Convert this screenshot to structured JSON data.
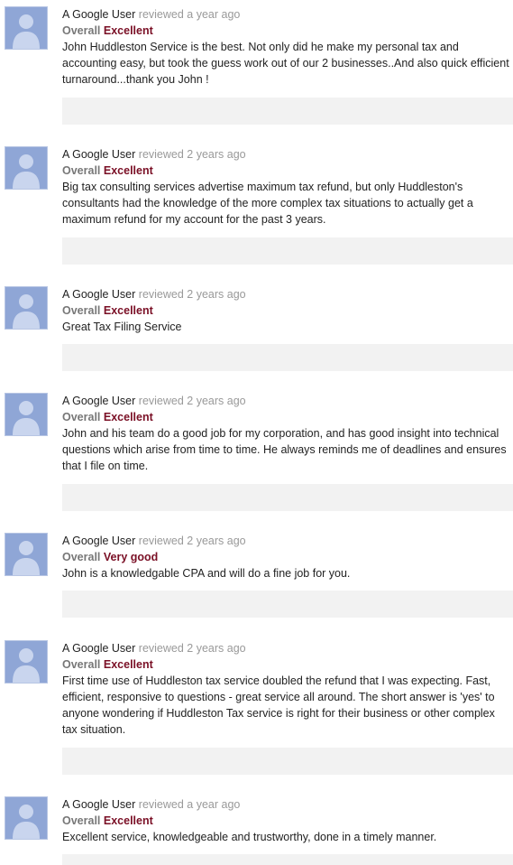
{
  "reviews": [
    {
      "author": "A Google User",
      "reviewed_text": "reviewed a year ago",
      "rating_label": "Overall",
      "rating_value": "Excellent",
      "text": "John Huddleston Service is the best. Not only did he make my personal tax and accounting easy, but took the guess work out of our 2 businesses..And also quick efficient turnaround...thank you John !"
    },
    {
      "author": "A Google User",
      "reviewed_text": "reviewed 2 years ago",
      "rating_label": "Overall",
      "rating_value": "Excellent",
      "text": "Big tax consulting services advertise maximum tax refund, but only Huddleston's consultants had the knowledge of the more complex tax situations to actually get a maximum refund for my account for the past 3 years."
    },
    {
      "author": "A Google User",
      "reviewed_text": "reviewed 2 years ago",
      "rating_label": "Overall",
      "rating_value": "Excellent",
      "text": "Great Tax Filing Service"
    },
    {
      "author": "A Google User",
      "reviewed_text": "reviewed 2 years ago",
      "rating_label": "Overall",
      "rating_value": "Excellent",
      "text": "John and his team do a good job for my corporation, and has good insight into technical questions which arise from time to time. He always reminds me of deadlines and ensures that I file on time."
    },
    {
      "author": "A Google User",
      "reviewed_text": "reviewed 2 years ago",
      "rating_label": "Overall",
      "rating_value": "Very good",
      "text": "John is a knowledgable CPA and will do a fine job for you."
    },
    {
      "author": "A Google User",
      "reviewed_text": "reviewed 2 years ago",
      "rating_label": "Overall",
      "rating_value": "Excellent",
      "text": "First time use of Huddleston tax service doubled the refund that I was expecting. Fast, efficient, responsive to questions - great service all around. The short answer is 'yes' to anyone wondering if Huddleston Tax service is right for their business or other complex tax situation."
    },
    {
      "author": "A Google User",
      "reviewed_text": "reviewed a year ago",
      "rating_label": "Overall",
      "rating_value": "Excellent",
      "text": "Excellent service, knowledgeable and trustworthy, done in a timely manner."
    }
  ],
  "icons": {
    "avatar": "default-user-avatar-icon"
  },
  "colors": {
    "rating_value": "#7a0f25",
    "rating_label": "#777777",
    "reviewed_text": "#999999",
    "avatar_bg": "#8fa6d6",
    "action_bar_bg": "#f2f2f2"
  }
}
